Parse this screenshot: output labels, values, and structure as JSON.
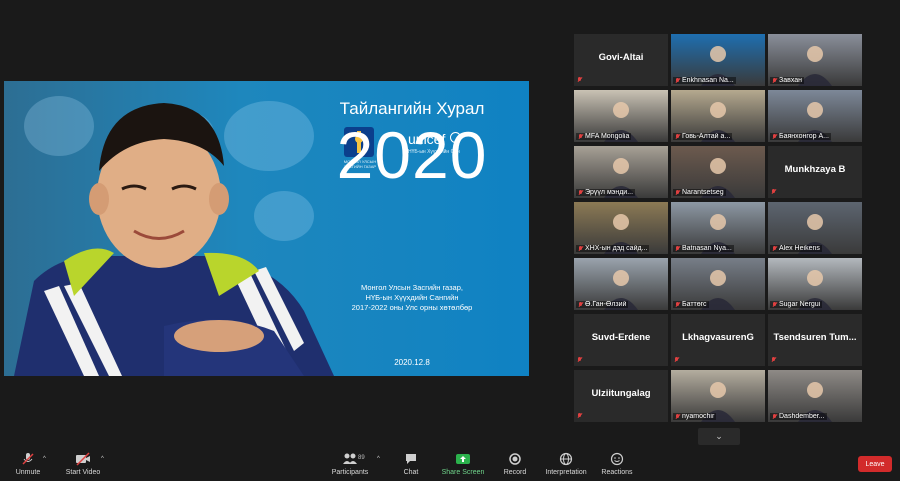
{
  "slide": {
    "title": "Тайлангийн Хурал",
    "year": "2020",
    "desc": [
      "Монгол Улсын Засгийн газар,",
      "НҮБ-ын Хүүхдийн Сангийн",
      "2017-2022 оны Улс орны хөтөлбөр"
    ],
    "date": "2020.12.8",
    "unicef": "unicef",
    "unicef_sub": "НҮБ-ын Хүүхдийн Сан",
    "mn_logo_text": "МОНГОЛ УЛСЫН ЗАСГИЙН ГАЗАР"
  },
  "gallery": [
    {
      "name": "Govi-Altai",
      "video": false
    },
    {
      "name": "Enkhnasan Na...",
      "video": true
    },
    {
      "name": "Завхан",
      "video": true
    },
    {
      "name": "MFA Mongolia",
      "video": true
    },
    {
      "name": "Говь-Алтай а...",
      "video": true
    },
    {
      "name": "Баянхонгор А...",
      "video": true
    },
    {
      "name": "Эрүүл мэнди...",
      "video": true
    },
    {
      "name": "Narantsetseg",
      "video": true
    },
    {
      "name": "Munkhzaya B",
      "video": false
    },
    {
      "name": "ХНХ-ын дэд сайд...",
      "video": true
    },
    {
      "name": "Batnasan Nya...",
      "video": true
    },
    {
      "name": "Alex Heikens",
      "video": true
    },
    {
      "name": "Ө.Ган-Өлзий",
      "video": true
    },
    {
      "name": "Баттөгс",
      "video": true
    },
    {
      "name": "Sugar Nergui",
      "video": true
    },
    {
      "name": "Suvd-Erdene",
      "video": false
    },
    {
      "name": "LkhagvasurenG",
      "video": false
    },
    {
      "name": "Tsendsuren Tum...",
      "video": false
    },
    {
      "name": "Ulziitungalag",
      "video": false
    },
    {
      "name": "nyamochir",
      "video": true
    },
    {
      "name": "Dashdember...",
      "video": true
    }
  ],
  "toolbar": {
    "unmute": "Unmute",
    "start_video": "Start Video",
    "participants": "Participants",
    "participants_count": "89",
    "chat": "Chat",
    "share_screen": "Share Screen",
    "record": "Record",
    "interpretation": "Interpretation",
    "reactions": "Reactions",
    "leave": "Leave"
  },
  "colors": {
    "share_green": "#2bb24c",
    "leave_red": "#d22b2b",
    "active_speaker": "#b8d03a",
    "slide_blue": "#1e87bd"
  }
}
